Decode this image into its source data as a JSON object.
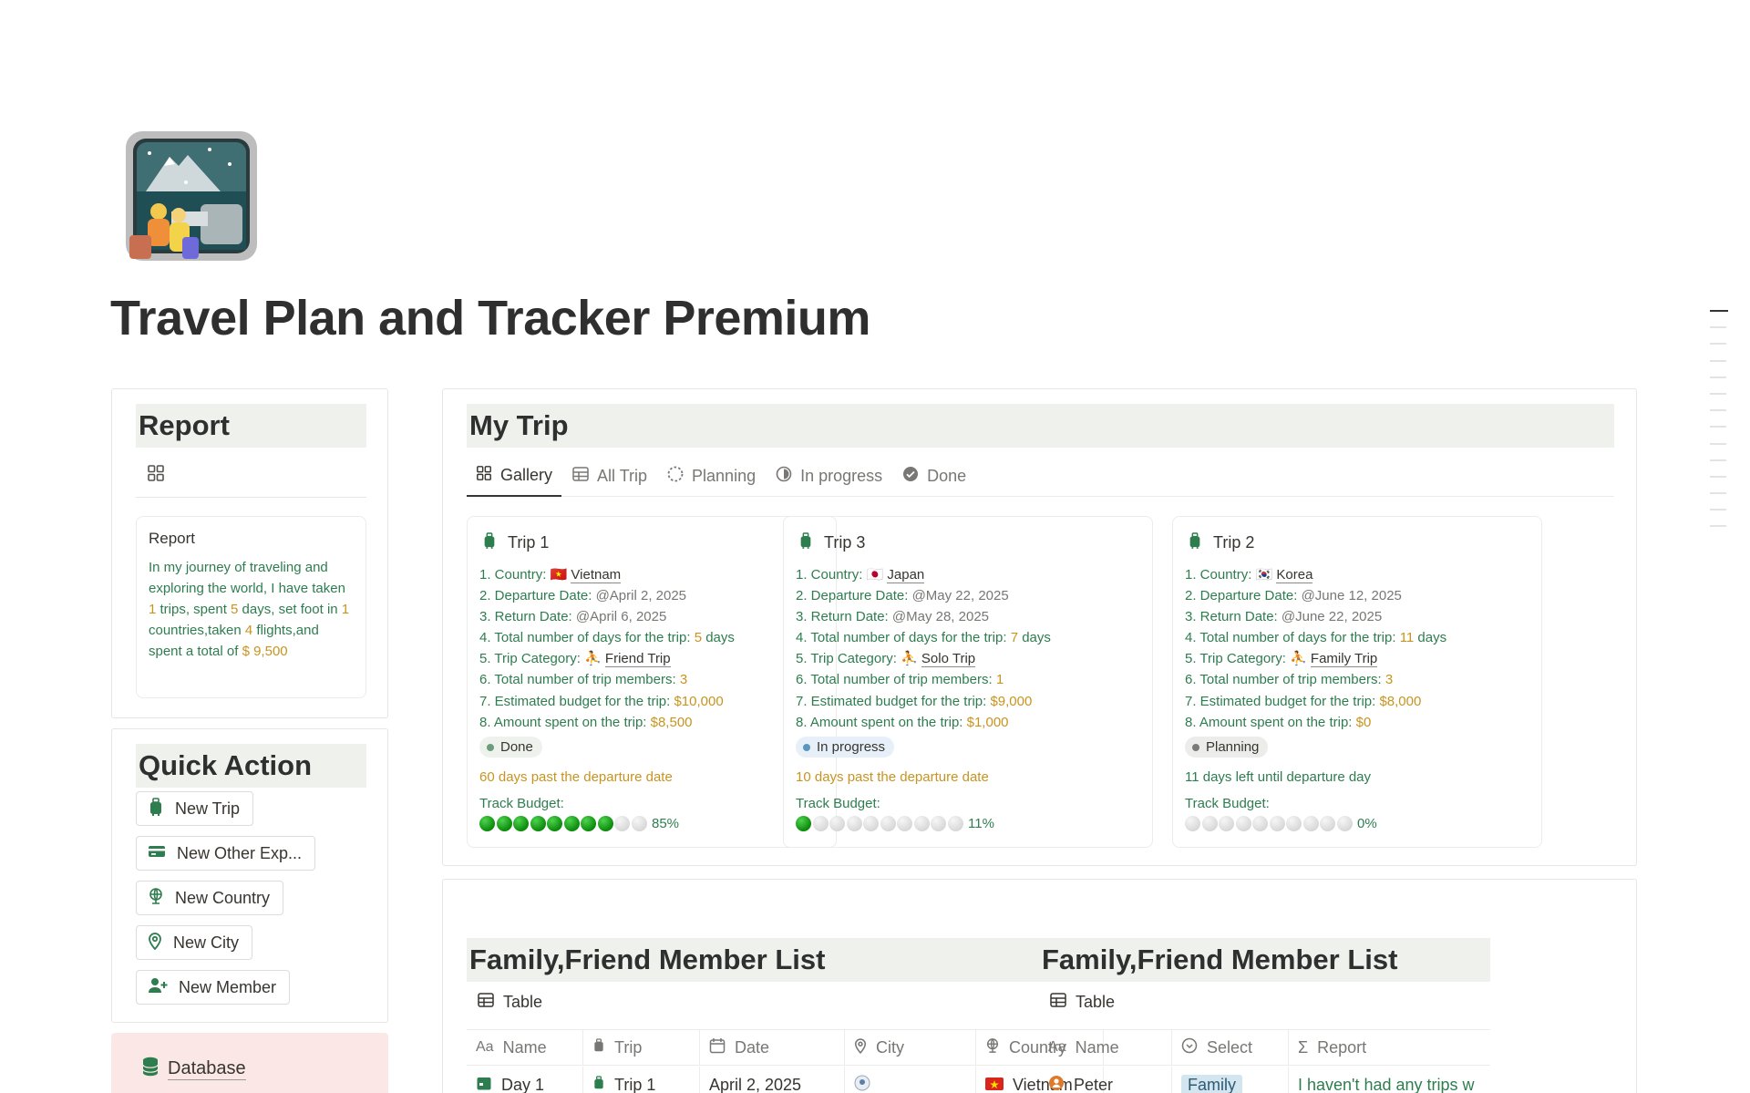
{
  "page": {
    "title": "Travel Plan and Tracker Premium"
  },
  "report": {
    "heading": "Report",
    "card_title": "Report",
    "summary": {
      "p1": "In my journey of traveling and exploring the world, I have taken ",
      "trips": "1",
      "p2": " trips, spent ",
      "days": "5",
      "p3": " days, set foot in ",
      "countries": "1",
      "p4": " countries,taken ",
      "flights": "4",
      "p5": " flights,and spent a total of ",
      "total": "$ 9,500"
    }
  },
  "quick_action": {
    "heading": "Quick Action",
    "buttons": [
      "New Trip",
      "New Other Exp...",
      "New Country",
      "New City",
      "New Member"
    ]
  },
  "database": {
    "label": "Database"
  },
  "my_trip": {
    "heading": "My Trip",
    "tabs": [
      "Gallery",
      "All Trip",
      "Planning",
      "In progress",
      "Done"
    ],
    "active_tab": "Gallery",
    "labels": {
      "country": "1. Country: ",
      "departure": "2. Departure  Date: ",
      "return": "3. Return  Date: ",
      "days": "4. Total number of days for the trip: ",
      "category": "5. Trip Category: ",
      "members": "6. Total number of trip members: ",
      "budget": "7. Estimated budget for the trip: ",
      "spent": "8. Amount spent on the trip: ",
      "track": "Track Budget:"
    },
    "trips": [
      {
        "name": "Trip 1",
        "country": "Vietnam",
        "country_flag": "🇻🇳",
        "departure": "@April 2, 2025",
        "return": "@April 6, 2025",
        "days": "5",
        "days_unit": " days",
        "category": "Friend Trip",
        "members": "3",
        "budget": "$10,000",
        "spent": "$8,500",
        "status": "Done",
        "status_color": "#6c9b7d",
        "status_bg": "#edf3ec",
        "note": "60 days past the departure date",
        "note_color": "#c8941f",
        "track_filled": 8,
        "track_total": 10,
        "track_pct": "85%"
      },
      {
        "name": "Trip 3",
        "country": "Japan",
        "country_flag": "🇯🇵",
        "departure": "@May 22, 2025",
        "return": "@May 28, 2025",
        "days": "7",
        "days_unit": " days",
        "category": "Solo Trip",
        "members": "1",
        "budget": "$9,000",
        "spent": "$1,000",
        "status": "In progress",
        "status_color": "#5b97bd",
        "status_bg": "#e7f0f8",
        "note": "10 days past the departure date",
        "note_color": "#c8941f",
        "track_filled": 1,
        "track_total": 10,
        "track_pct": "11%"
      },
      {
        "name": "Trip 2",
        "country": "Korea",
        "country_flag": "🇰🇷",
        "departure": "@June 12, 2025",
        "return": "@June 22, 2025",
        "days": "11",
        "days_unit": " days",
        "category": "Family Trip",
        "members": "3",
        "budget": "$8,000",
        "spent": "$0",
        "status": "Planning",
        "status_color": "#7a7a78",
        "status_bg": "#ececea",
        "note": "11 days left until departure day",
        "note_color": "#2e7d4f",
        "track_filled": 0,
        "track_total": 10,
        "track_pct": "0%"
      }
    ]
  },
  "member_list_left": {
    "heading": "Family,Friend Member List",
    "view": "Table",
    "columns": [
      "Name",
      "Trip",
      "Date",
      "City",
      "Country"
    ],
    "row": {
      "name": "Day 1",
      "trip": "Trip 1",
      "date": "April 2, 2025",
      "city": "",
      "country": "Vietnam"
    }
  },
  "member_list_right": {
    "heading": "Family,Friend Member List",
    "view": "Table",
    "columns": [
      "Name",
      "Select",
      "Report"
    ],
    "row": {
      "name": "Peter",
      "select": "Family",
      "report": "I haven't had any trips w"
    }
  },
  "colors": {
    "accent_green": "#2e7d4f",
    "accent_orange": "#c8941f",
    "header_bg": "#eef1ec",
    "database_bg": "#fbe8e6"
  }
}
